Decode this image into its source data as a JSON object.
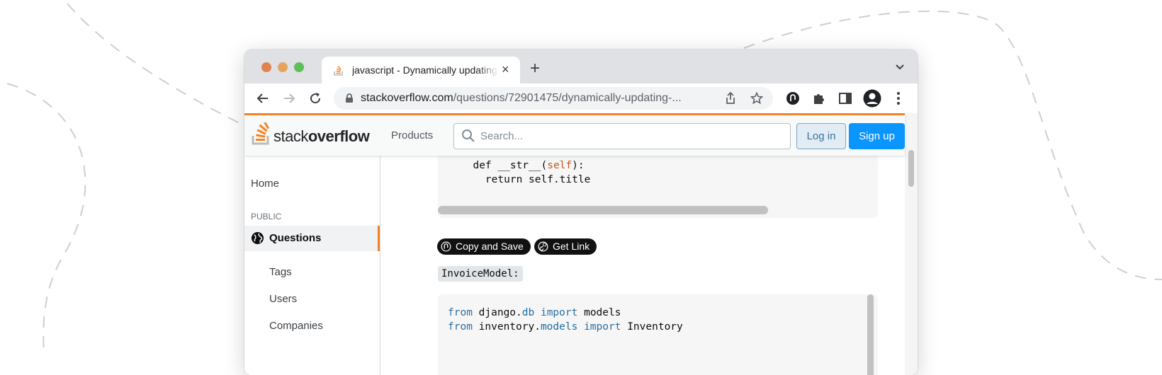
{
  "browser": {
    "tab_title": "javascript - Dynamically updating - Stack Overflow",
    "new_tab_label": "+",
    "tab_close_label": "×",
    "url_domain": "stackoverflow.com",
    "url_path": "/questions/72901475/dynamically-updating-..."
  },
  "site": {
    "logo_word_1": "stack",
    "logo_word_2": "overflow",
    "nav_products": "Products",
    "search_placeholder": "Search...",
    "login_label": "Log in",
    "signup_label": "Sign up",
    "brand_accent": "#f48225",
    "primary_button": "#0a95ff"
  },
  "sidebar": {
    "home": "Home",
    "section_public": "PUBLIC",
    "active_item": "Questions",
    "items": [
      "Tags",
      "Users",
      "Companies"
    ]
  },
  "post": {
    "snippet_buttons": [
      "Copy and Save",
      "Get Link"
    ],
    "inline_label": "InvoiceModel:"
  },
  "icons": [
    "stackoverflow-favicon",
    "close-icon",
    "plus-icon",
    "chevron-down-icon",
    "back-arrow-icon",
    "forward-arrow-icon",
    "reload-icon",
    "lock-icon",
    "share-icon",
    "star-icon",
    "extension-copy-icon",
    "puzzle-icon",
    "sidepanel-icon",
    "profile-icon",
    "kebab-menu-icon",
    "search-icon",
    "globe-icon",
    "link-icon"
  ]
}
